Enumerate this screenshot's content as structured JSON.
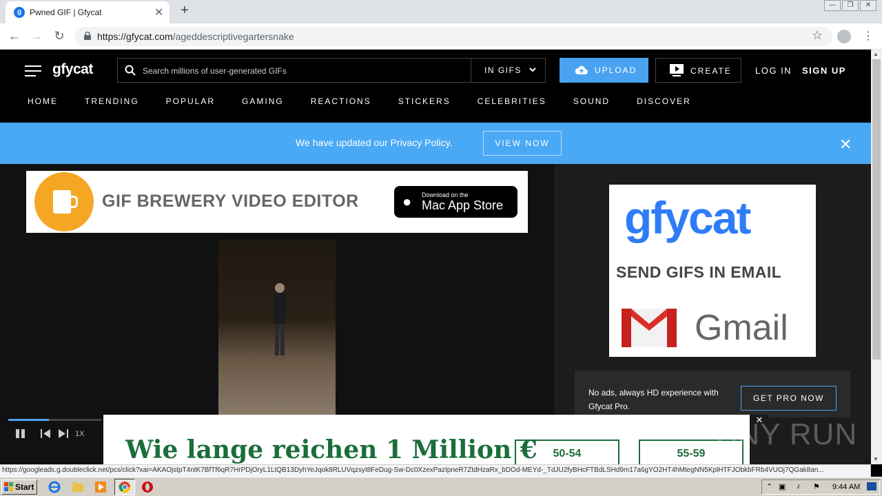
{
  "browser": {
    "tab_title": "Pwned GIF | Gfycat",
    "url_domain": "https://gfycat.com",
    "url_path": "/ageddescriptivegartersnake",
    "status_url": "https://googleads.g.doubleclick.net/pcs/click?xai=AKAOjstpT4ntK7BfTf6qR7HrPDjOryL1LtQB13DyhYeJqok8RLUVqzsyI8FeDug-Sw-Dc0XzexPazIpneR7ZtdHzaRx_bDOd-MEYd-_TdJU2fyBHcFTBdLSHd9m17a6gYO2HT4hMtegNN5KplHTFJObkbFRb4VUOj7QGak8an..."
  },
  "header": {
    "logo": "gfycat",
    "search_placeholder": "Search millions of user-generated GIFs",
    "search_filter": "IN GIFS",
    "upload_label": "UPLOAD",
    "create_label": "CREATE",
    "login_label": "LOG IN",
    "signup_label": "SIGN UP"
  },
  "nav": [
    "HOME",
    "TRENDING",
    "POPULAR",
    "GAMING",
    "REACTIONS",
    "STICKERS",
    "CELEBRITIES",
    "SOUND",
    "DISCOVER"
  ],
  "privacy_banner": {
    "text": "We have updated our Privacy Policy.",
    "button": "VIEW NOW",
    "close": "✕"
  },
  "ad_top": {
    "title": "GIF BREWERY VIDEO EDITOR",
    "store_small": "Download on the",
    "store_big": "Mac App Store"
  },
  "ad_right": {
    "logo": "gfycat",
    "tagline": "SEND GIFS IN EMAIL",
    "gmail": "Gmail"
  },
  "pro": {
    "text": "No ads, always HD experience with Gfycat Pro.",
    "button": "GET PRO NOW"
  },
  "player": {
    "speed": "1X",
    "progress": 0.44
  },
  "ad_bottom": {
    "title": "Wie lange reichen 1 Million €",
    "options": [
      "50-54",
      "55-59"
    ],
    "close": "✕"
  },
  "watermark": "ANY RUN",
  "taskbar": {
    "start": "Start",
    "clock": "9:44 AM"
  },
  "colors": {
    "accent": "#4aa3f0",
    "banner": "#4aa9f5",
    "ad_green": "#1a6e3a"
  }
}
